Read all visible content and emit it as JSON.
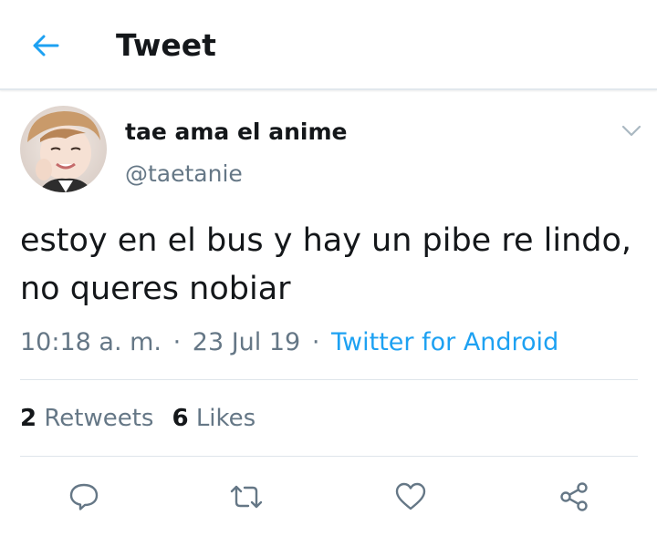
{
  "header": {
    "title": "Tweet",
    "back_icon": "arrow-left-icon",
    "accent_color": "#1da1f2"
  },
  "tweet": {
    "display_name": "tae ama el anime",
    "handle": "@taetanie",
    "text": "estoy en el bus y hay un pibe re lindo, no queres nobiar",
    "time": "10:18 a. m.",
    "separator": "·",
    "date": "23 Jul 19",
    "source": "Twitter for Android"
  },
  "stats": {
    "retweets_count": "2",
    "retweets_label": "Retweets",
    "likes_count": "6",
    "likes_label": "Likes"
  },
  "actions": {
    "reply_icon": "reply-icon",
    "retweet_icon": "retweet-icon",
    "like_icon": "heart-icon",
    "share_icon": "share-icon"
  },
  "colors": {
    "text_primary": "#14171a",
    "text_secondary": "#657786",
    "link": "#1da1f2",
    "divider": "#e1e8ed"
  }
}
